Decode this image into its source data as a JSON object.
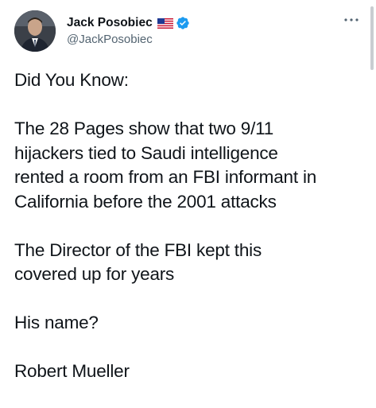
{
  "tweet": {
    "author": {
      "display_name": "Jack Posobiec",
      "handle": "@JackPosobiec",
      "flag_icon": "us-flag-icon",
      "verified_icon": "verified-badge-icon",
      "verified_color": "#1d9bf0"
    },
    "more_icon": "more-horizontal-icon",
    "paragraphs": [
      [
        "Did You Know:"
      ],
      [
        "The 28 Pages show that two 9/11",
        "hijackers tied to Saudi intelligence",
        "rented a room from an FBI informant in",
        "California before the 2001 attacks"
      ],
      [
        "The Director of the FBI kept this",
        "covered up for years"
      ],
      [
        "His name?"
      ],
      [
        "Robert Mueller"
      ]
    ]
  },
  "colors": {
    "text": "#0f1419",
    "secondary": "#536471",
    "accent": "#1d9bf0",
    "background": "#ffffff"
  }
}
